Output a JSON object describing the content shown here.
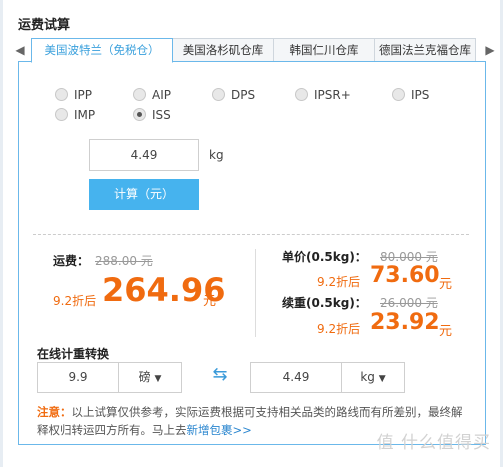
{
  "title": "运费试算",
  "tabs": [
    {
      "label": "美国波特兰（免税仓）",
      "active": true
    },
    {
      "label": "美国洛杉矶仓库",
      "active": false
    },
    {
      "label": "韩国仁川仓库",
      "active": false
    },
    {
      "label": "德国法兰克福仓库",
      "active": false
    }
  ],
  "shipping_methods": [
    {
      "label": "IPP",
      "checked": false
    },
    {
      "label": "AIP",
      "checked": false
    },
    {
      "label": "DPS",
      "checked": false
    },
    {
      "label": "IPSR+",
      "checked": false
    },
    {
      "label": "IPS",
      "checked": false
    },
    {
      "label": "IMP",
      "checked": false
    },
    {
      "label": "ISS",
      "checked": true
    }
  ],
  "weight": {
    "value": "4.49",
    "unit": "kg"
  },
  "calc_button": "计算（元）",
  "freight": {
    "label": "运费：",
    "original": "288.00 元",
    "discount": "9.2折后",
    "price": "264.96",
    "currency": "元"
  },
  "unit_price": {
    "label": "单价(0.5kg)：",
    "original": "80.000 元",
    "discount": "9.2折后",
    "price": "73.60",
    "currency": "元"
  },
  "continued_weight": {
    "label": "续重(0.5kg)：",
    "original": "26.000 元",
    "discount": "9.2折后",
    "price": "23.92",
    "currency": "元"
  },
  "converter": {
    "title": "在线计重转换",
    "left_value": "9.9",
    "left_unit": "磅",
    "swap_icon": "swap-arrows-icon",
    "right_value": "4.49",
    "right_unit": "kg"
  },
  "note": {
    "prefix": "注意：",
    "text": "以上试算仅供参考，实际运费根据可支持相关品类的路线而有所差别，最终解释权归转运四方所有。马上去",
    "link": "新增包裹>>"
  },
  "watermark": "值 什么值得买",
  "colors": {
    "accent": "#46b3ee",
    "price": "#f06b10",
    "border": "#6bb8ea"
  }
}
